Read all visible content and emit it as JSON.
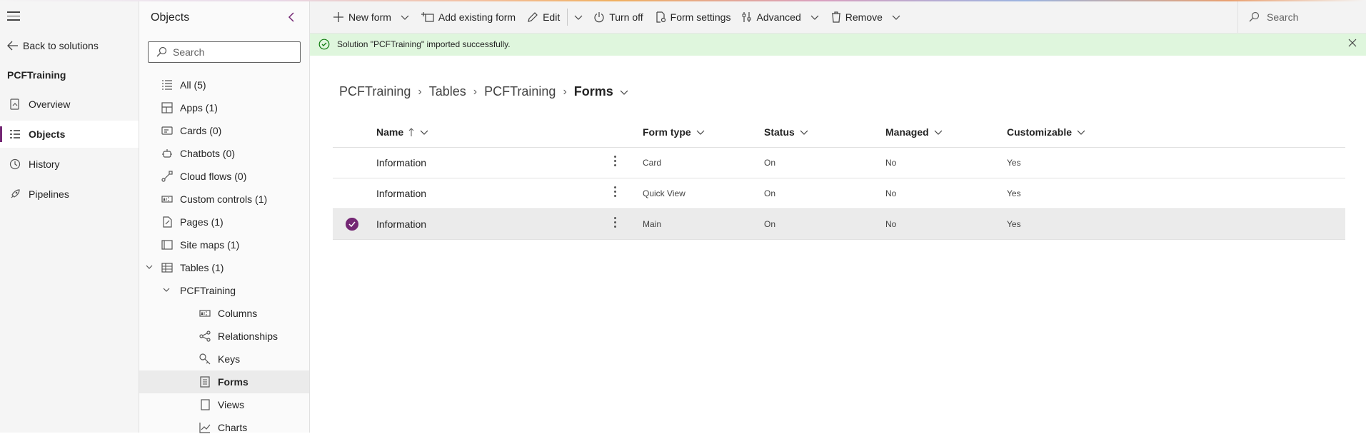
{
  "left_nav": {
    "back_label": "Back to solutions",
    "solution_name": "PCFTraining",
    "items": [
      {
        "label": "Overview",
        "icon": "overview-icon"
      },
      {
        "label": "Objects",
        "icon": "objects-icon",
        "active": true
      },
      {
        "label": "History",
        "icon": "history-icon"
      },
      {
        "label": "Pipelines",
        "icon": "rocket-icon"
      }
    ]
  },
  "objects_panel": {
    "title": "Objects",
    "search_placeholder": "Search",
    "tree": [
      {
        "label": "All  (5)",
        "icon": "list-icon"
      },
      {
        "label": "Apps  (1)",
        "icon": "apps-icon"
      },
      {
        "label": "Cards  (0)",
        "icon": "card-icon"
      },
      {
        "label": "Chatbots  (0)",
        "icon": "bot-icon"
      },
      {
        "label": "Cloud flows  (0)",
        "icon": "flow-icon"
      },
      {
        "label": "Custom controls  (1)",
        "icon": "control-icon"
      },
      {
        "label": "Pages  (1)",
        "icon": "page-icon"
      },
      {
        "label": "Site maps  (1)",
        "icon": "sitemap-icon"
      },
      {
        "label": "Tables  (1)",
        "icon": "table-icon"
      },
      {
        "label": "PCFTraining",
        "icon": ""
      },
      {
        "label": "Columns",
        "icon": "column-icon"
      },
      {
        "label": "Relationships",
        "icon": "relationship-icon"
      },
      {
        "label": "Keys",
        "icon": "key-icon"
      },
      {
        "label": "Forms",
        "icon": "form-icon",
        "selected": true
      },
      {
        "label": "Views",
        "icon": "view-icon"
      },
      {
        "label": "Charts",
        "icon": "chart-icon"
      }
    ]
  },
  "command_bar": {
    "new_form": "New form",
    "add_existing_form": "Add existing form",
    "edit": "Edit",
    "turn_off": "Turn off",
    "form_settings": "Form settings",
    "advanced": "Advanced",
    "remove": "Remove",
    "search_placeholder": "Search"
  },
  "banner": {
    "message": "Solution \"PCFTraining\" imported successfully."
  },
  "breadcrumb": {
    "items": [
      "PCFTraining",
      "Tables",
      "PCFTraining"
    ],
    "current": "Forms"
  },
  "grid": {
    "columns": {
      "name": "Name",
      "form_type": "Form type",
      "status": "Status",
      "managed": "Managed",
      "customizable": "Customizable"
    },
    "rows": [
      {
        "name": "Information",
        "form_type": "Card",
        "status": "On",
        "managed": "No",
        "customizable": "Yes",
        "selected": false
      },
      {
        "name": "Information",
        "form_type": "Quick View",
        "status": "On",
        "managed": "No",
        "customizable": "Yes",
        "selected": false
      },
      {
        "name": "Information",
        "form_type": "Main",
        "status": "On",
        "managed": "No",
        "customizable": "Yes",
        "selected": true
      }
    ]
  },
  "colors": {
    "accent": "#742774",
    "banner_bg": "#dff6dd",
    "success": "#107c10"
  }
}
